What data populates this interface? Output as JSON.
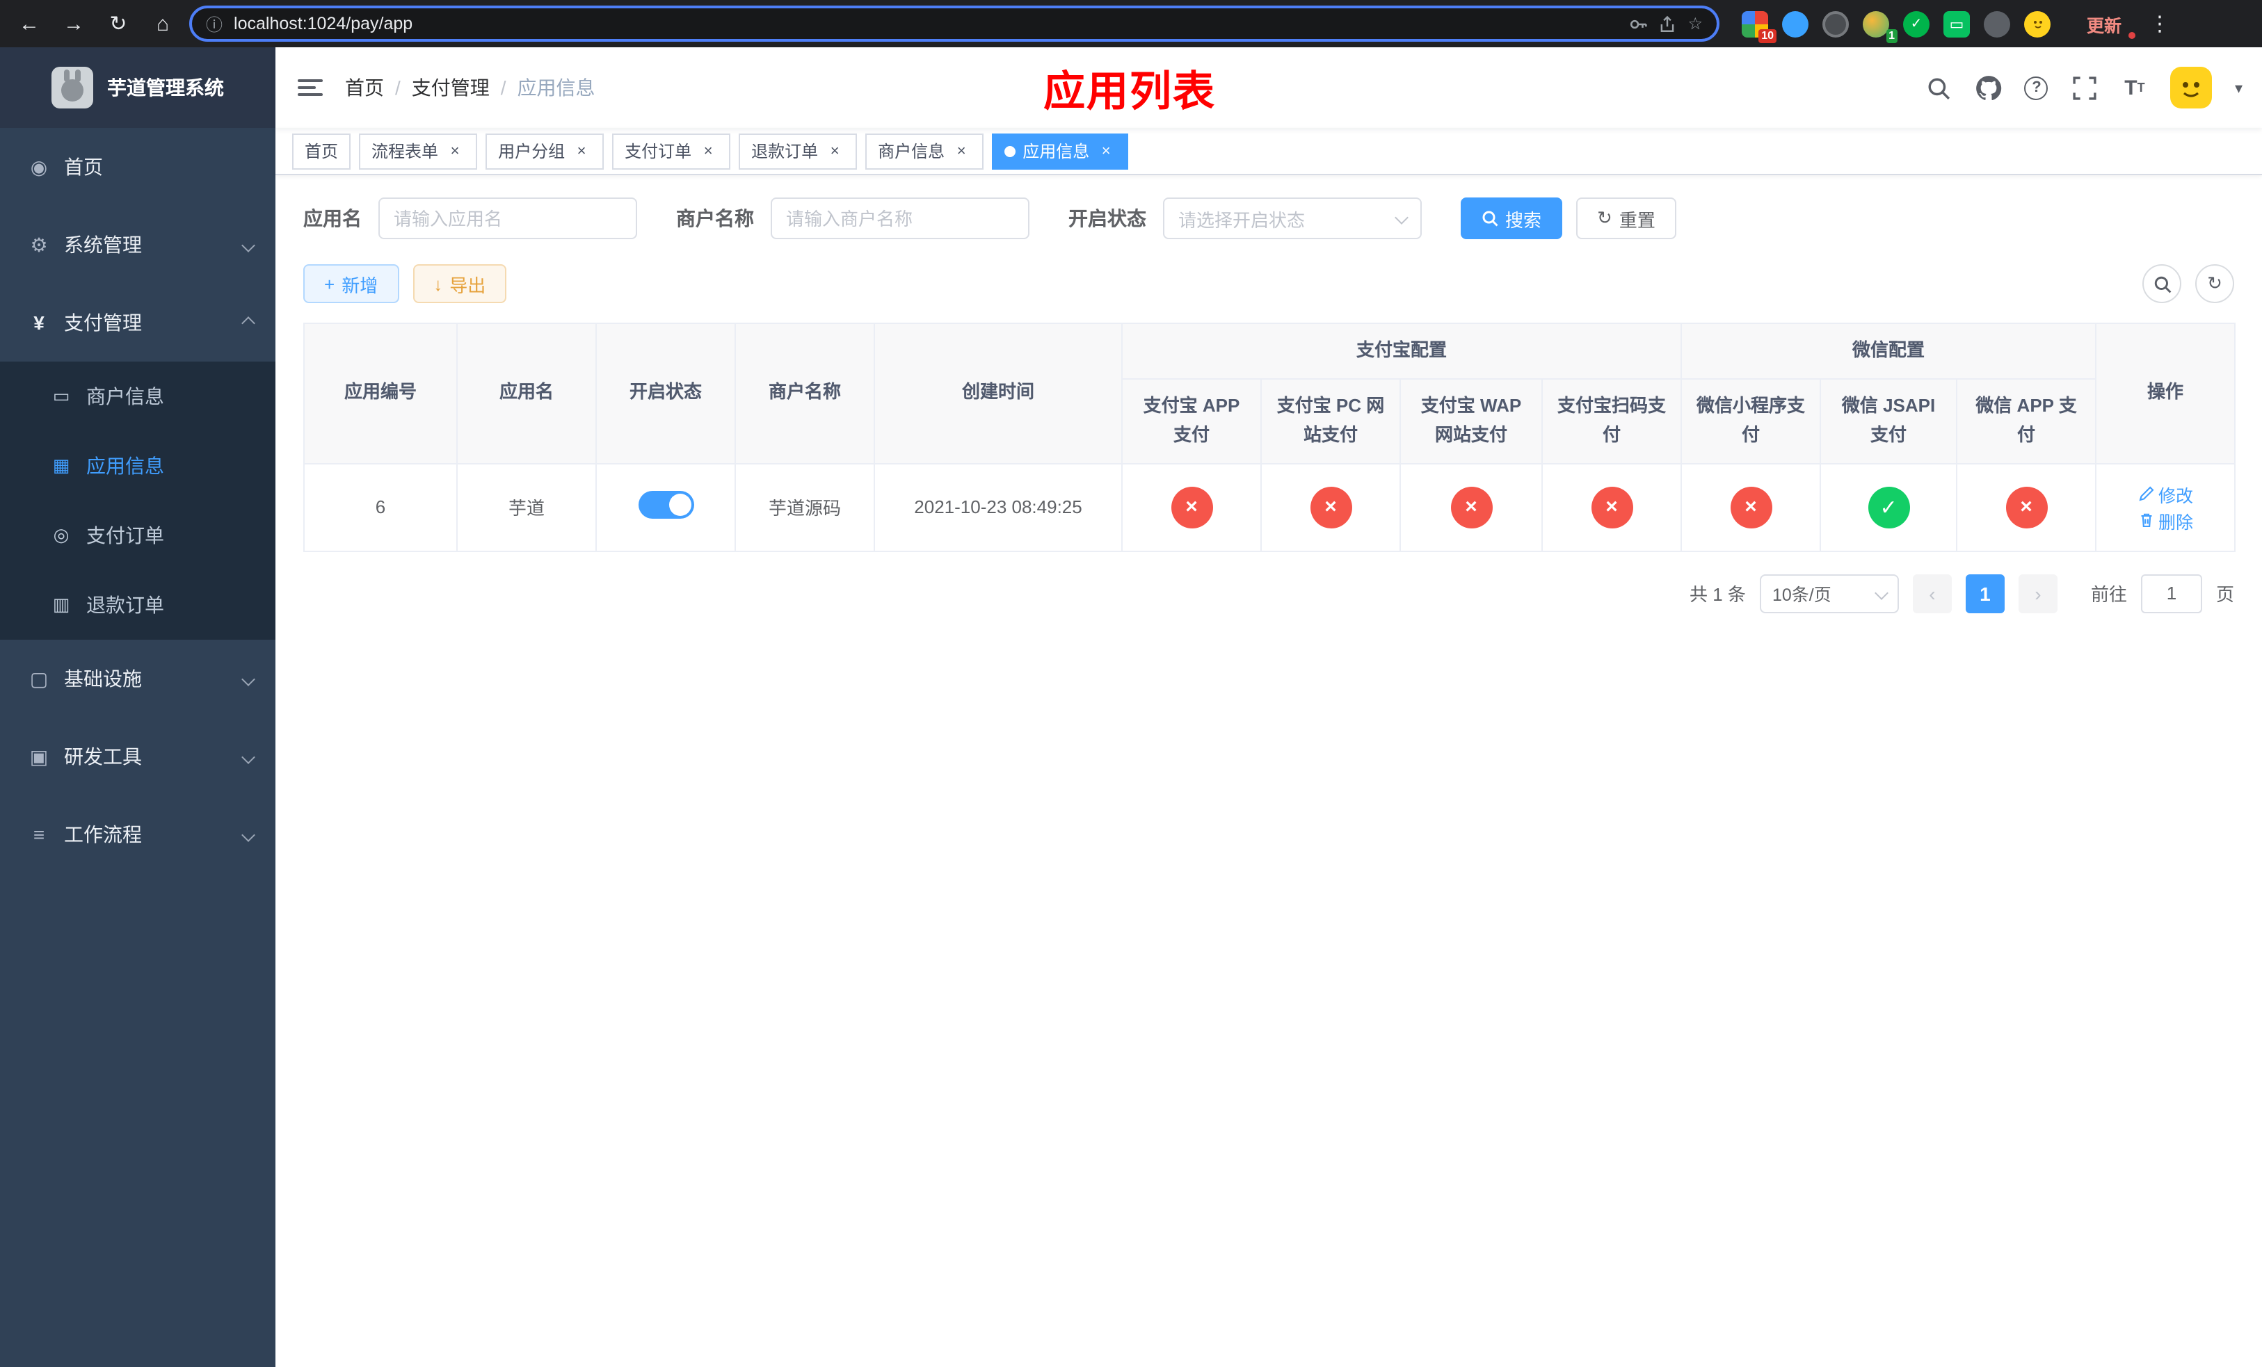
{
  "browser": {
    "url": "localhost:1024/pay/app",
    "update_label": "更新",
    "extension_badge_grid": "10",
    "extension_badge_avatar": "1"
  },
  "sidebar": {
    "title": "芋道管理系统",
    "items": [
      {
        "label": "首页",
        "icon": "dashboard"
      },
      {
        "label": "系统管理",
        "icon": "gear"
      },
      {
        "label": "支付管理",
        "icon": "yen",
        "children": [
          {
            "label": "商户信息",
            "icon": "merchant"
          },
          {
            "label": "应用信息",
            "icon": "app-grid"
          },
          {
            "label": "支付订单",
            "icon": "order"
          },
          {
            "label": "退款订单",
            "icon": "refund"
          }
        ]
      },
      {
        "label": "基础设施",
        "icon": "infra"
      },
      {
        "label": "研发工具",
        "icon": "tools"
      },
      {
        "label": "工作流程",
        "icon": "workflow"
      }
    ]
  },
  "header": {
    "breadcrumb": [
      "首页",
      "支付管理",
      "应用信息"
    ],
    "page_title": "应用列表"
  },
  "tabs": [
    {
      "label": "首页"
    },
    {
      "label": "流程表单"
    },
    {
      "label": "用户分组"
    },
    {
      "label": "支付订单"
    },
    {
      "label": "退款订单"
    },
    {
      "label": "商户信息"
    },
    {
      "label": "应用信息"
    }
  ],
  "filters": {
    "app_name_label": "应用名",
    "app_name_placeholder": "请输入应用名",
    "merchant_label": "商户名称",
    "merchant_placeholder": "请输入商户名称",
    "status_label": "开启状态",
    "status_placeholder": "请选择开启状态",
    "search_label": "搜索",
    "reset_label": "重置"
  },
  "toolbar": {
    "add_label": "新增",
    "export_label": "导出"
  },
  "table": {
    "group_alipay": "支付宝配置",
    "group_wechat": "微信配置",
    "col_id": "应用编号",
    "col_name": "应用名",
    "col_status": "开启状态",
    "col_merchant": "商户名称",
    "col_created": "创建时间",
    "col_alipay_app": "支付宝 APP 支付",
    "col_alipay_pc": "支付宝 PC 网站支付",
    "col_alipay_wap": "支付宝 WAP 网站支付",
    "col_alipay_qr": "支付宝扫码支付",
    "col_wx_mini": "微信小程序支付",
    "col_wx_jsapi": "微信 JSAPI 支付",
    "col_wx_app": "微信 APP 支付",
    "col_op": "操作",
    "rows": [
      {
        "id": "6",
        "name": "芋道",
        "enabled": true,
        "merchant": "芋道源码",
        "created": "2021-10-23 08:49:25",
        "configs": {
          "alipay_app": false,
          "alipay_pc": false,
          "alipay_wap": false,
          "alipay_qr": false,
          "wx_mini": false,
          "wx_jsapi": true,
          "wx_app": false
        },
        "edit_label": "修改",
        "delete_label": "删除"
      }
    ]
  },
  "pagination": {
    "total": "共 1 条",
    "page_size": "10条/页",
    "current_page": "1",
    "goto_label": "前往",
    "goto_value": "1",
    "unit_label": "页"
  },
  "colors": {
    "primary": "#409eff",
    "title_red": "#ff0000",
    "success": "#13ce66",
    "danger": "#f5554a",
    "warning": "#e6a23c",
    "sidebar_bg": "#304156",
    "submenu_bg": "#1f2d3d"
  },
  "icons": {
    "back": "←",
    "forward": "→",
    "reload": "↻",
    "home": "⌂",
    "star": "☆",
    "kebab": "⋮",
    "caret": "▾",
    "info": "ⓘ",
    "dashboard": "◉",
    "gear": "⚙",
    "yen": "¥",
    "merchant": "▭",
    "app-grid": "▦",
    "order": "◎",
    "refund": "▥",
    "infra": "▢",
    "tools": "▣",
    "workflow": "≡",
    "plus": "+",
    "download": "↓",
    "refresh": "↻",
    "check": "✓",
    "cross": "×",
    "prev": "‹",
    "next": "›"
  }
}
